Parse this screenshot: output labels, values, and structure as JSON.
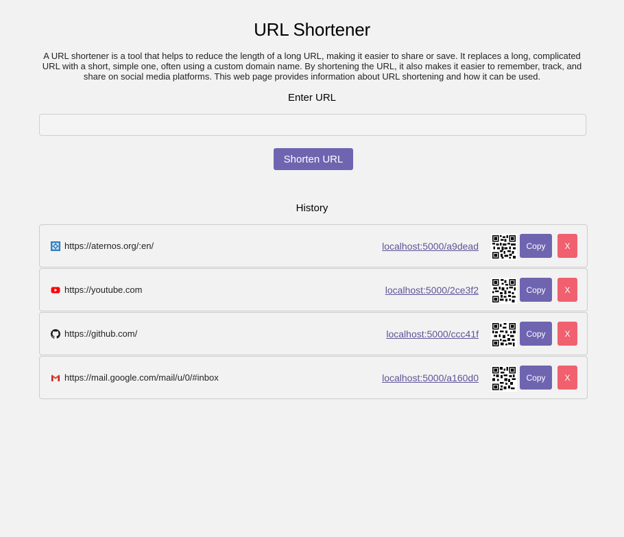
{
  "header": {
    "title": "URL Shortener",
    "description": "A URL shortener is a tool that helps to reduce the length of a long URL, making it easier to share or save. It replaces a long, complicated URL with a short, simple one, often using a custom domain name. By shortening the URL, it also makes it easier to remember, track, and share on social media platforms. This web page provides information about URL shortening and how it can be used."
  },
  "form": {
    "label": "Enter URL",
    "input_value": "",
    "input_placeholder": "",
    "button_label": "Shorten URL"
  },
  "history": {
    "title": "History",
    "items": [
      {
        "favicon": "aternos-icon",
        "url": "https://aternos.org/:en/",
        "short": "localhost:5000/a9dead",
        "copy_label": "Copy",
        "delete_label": "X"
      },
      {
        "favicon": "youtube-icon",
        "url": "https://youtube.com",
        "short": "localhost:5000/2ce3f2",
        "copy_label": "Copy",
        "delete_label": "X"
      },
      {
        "favicon": "github-icon",
        "url": "https://github.com/",
        "short": "localhost:5000/ccc41f",
        "copy_label": "Copy",
        "delete_label": "X"
      },
      {
        "favicon": "gmail-icon",
        "url": "https://mail.google.com/mail/u/0/#inbox",
        "short": "localhost:5000/a160d0",
        "copy_label": "Copy",
        "delete_label": "X"
      }
    ]
  },
  "colors": {
    "accent": "#6f64b0",
    "danger": "#f0606e",
    "link": "#5f5296",
    "background": "#f2f2f2"
  }
}
